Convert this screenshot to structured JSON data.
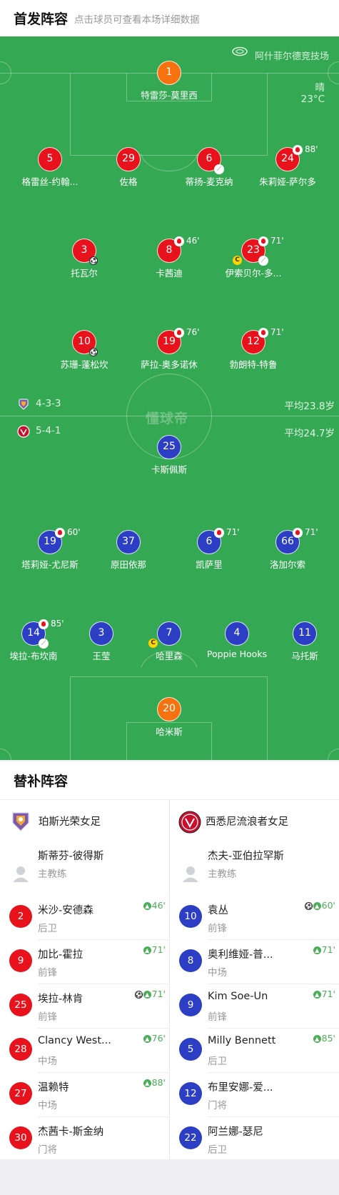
{
  "starting": {
    "title": "首发阵容",
    "subtitle": "点击球员可查看本场详细数据"
  },
  "venue": {
    "name": "阿什菲尔德竞技场",
    "icon": "stadium-icon"
  },
  "weather": {
    "condition": "晴",
    "temperature": "23°C"
  },
  "watermark": "懂球帝",
  "colors": {
    "pitch": "#35a853",
    "home_red": "#e8121c",
    "away_blue": "#2c3fc4",
    "goalkeeper_orange": "#f5720f",
    "sub_green": "#4cae58"
  },
  "top_team": {
    "formation": "4-3-3",
    "avg_age": "平均23.8岁",
    "players": [
      {
        "number": "1",
        "name": "特雷莎-莫里西",
        "color": "orange"
      },
      {
        "number": "5",
        "name": "格雷丝-约翰...",
        "color": "red"
      },
      {
        "number": "29",
        "name": "佐格",
        "color": "red"
      },
      {
        "number": "6",
        "name": "蒂扬-麦克纳",
        "color": "red",
        "boot": true
      },
      {
        "number": "24",
        "name": "朱莉娅-萨尔多",
        "color": "red",
        "sub_minute": "88'"
      },
      {
        "number": "3",
        "name": "托瓦尔",
        "color": "red",
        "goal": true
      },
      {
        "number": "8",
        "name": "卡茜迪",
        "color": "red",
        "sub_minute": "46'"
      },
      {
        "number": "23",
        "name": "伊索贝尔-多...",
        "color": "red",
        "sub_minute": "71'",
        "captain": "C",
        "boot": true
      },
      {
        "number": "10",
        "name": "苏珊-蓬松坎",
        "color": "red",
        "goal": true
      },
      {
        "number": "19",
        "name": "萨拉-奥多诺休",
        "color": "red",
        "sub_minute": "76'"
      },
      {
        "number": "12",
        "name": "勃朗特-特鲁",
        "color": "red",
        "sub_minute": "71'"
      }
    ]
  },
  "bottom_team": {
    "formation": "5-4-1",
    "avg_age": "平均24.7岁",
    "players": [
      {
        "number": "25",
        "name": "卡斯佩斯",
        "color": "blue"
      },
      {
        "number": "19",
        "name": "塔莉娅-尤尼斯",
        "color": "blue",
        "sub_minute": "60'"
      },
      {
        "number": "37",
        "name": "原田依那",
        "color": "blue"
      },
      {
        "number": "6",
        "name": "凯萨里",
        "color": "blue",
        "sub_minute": "71'"
      },
      {
        "number": "66",
        "name": "洛加尔索",
        "color": "blue",
        "sub_minute": "71'"
      },
      {
        "number": "14",
        "name": "埃拉-布坎南",
        "color": "blue",
        "sub_minute": "85'",
        "boot": true
      },
      {
        "number": "3",
        "name": "王莹",
        "color": "blue"
      },
      {
        "number": "7",
        "name": "哈里森",
        "color": "blue",
        "captain": "C"
      },
      {
        "number": "4",
        "name": "Poppie Hooks",
        "color": "blue"
      },
      {
        "number": "11",
        "name": "马托斯",
        "color": "blue"
      },
      {
        "number": "20",
        "name": "哈米斯",
        "color": "orange"
      }
    ]
  },
  "substitutes": {
    "title": "替补阵容",
    "home": {
      "team_name": "珀斯光荣女足",
      "coach_name": "斯蒂芬-彼得斯",
      "coach_role": "主教练",
      "players": [
        {
          "number": "2",
          "name": "米沙-安德森",
          "position": "后卫",
          "minute": "46'"
        },
        {
          "number": "9",
          "name": "加比-霍拉",
          "position": "前锋",
          "minute": "71'"
        },
        {
          "number": "25",
          "name": "埃拉-林肯",
          "position": "前锋",
          "minute": "71'",
          "goal": true
        },
        {
          "number": "28",
          "name": "Clancy West...",
          "position": "中场",
          "minute": "76'"
        },
        {
          "number": "27",
          "name": "温赖特",
          "position": "中场",
          "minute": "88'"
        },
        {
          "number": "30",
          "name": "杰茜卡-斯金纳",
          "position": "门将",
          "minute": ""
        }
      ]
    },
    "away": {
      "team_name": "西悉尼流浪者女足",
      "coach_name": "杰夫-亚伯拉罕斯",
      "coach_role": "主教练",
      "players": [
        {
          "number": "10",
          "name": "袁丛",
          "position": "前锋",
          "minute": "60'",
          "goal": true
        },
        {
          "number": "8",
          "name": "奥利维娅-普...",
          "position": "中场",
          "minute": "71'"
        },
        {
          "number": "9",
          "name": "Kim Soe-Un",
          "position": "前锋",
          "minute": "71'"
        },
        {
          "number": "5",
          "name": "Milly Bennett",
          "position": "后卫",
          "minute": "85'"
        },
        {
          "number": "12",
          "name": "布里安娜-爱...",
          "position": "门将",
          "minute": ""
        },
        {
          "number": "22",
          "name": "阿兰娜-瑟尼",
          "position": "后卫",
          "minute": ""
        }
      ]
    }
  }
}
